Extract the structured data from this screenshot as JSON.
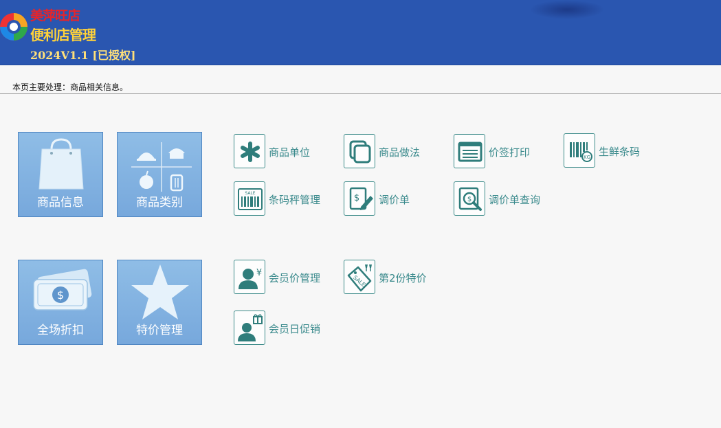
{
  "header": {
    "store_name": "美萍旺店",
    "app_name": "便利店管理",
    "version": "2024V1.1 [已授权]"
  },
  "description": "本页主要处理：商品相关信息。",
  "tiles": [
    {
      "label": "商品信息",
      "icon": "shopping-bag-icon"
    },
    {
      "label": "商品类别",
      "icon": "food-category-icon"
    },
    {
      "label": "全场折扣",
      "icon": "cash-icon"
    },
    {
      "label": "特价管理",
      "icon": "star-icon"
    }
  ],
  "items": [
    {
      "label": "商品单位",
      "icon": "asterisk-icon"
    },
    {
      "label": "商品做法",
      "icon": "copy-icon"
    },
    {
      "label": "价签打印",
      "icon": "price-tag-list-icon"
    },
    {
      "label": "生鲜条码",
      "icon": "barcode-kg-icon"
    },
    {
      "label": "条码秤管理",
      "icon": "barcode-sale-icon"
    },
    {
      "label": "调价单",
      "icon": "price-edit-icon"
    },
    {
      "label": "调价单查询",
      "icon": "price-search-icon"
    },
    {
      "label": "会员价管理",
      "icon": "member-price-icon"
    },
    {
      "label": "第2份特价",
      "icon": "sale-tag-icon"
    },
    {
      "label": "会员日促销",
      "icon": "member-gift-icon"
    }
  ],
  "colors": {
    "header_bg": "#2a56b0",
    "store_name": "#e8242a",
    "app_name": "#ffd23a",
    "tile_bg": "#80b2e0",
    "item_text": "#3a8a8c"
  }
}
